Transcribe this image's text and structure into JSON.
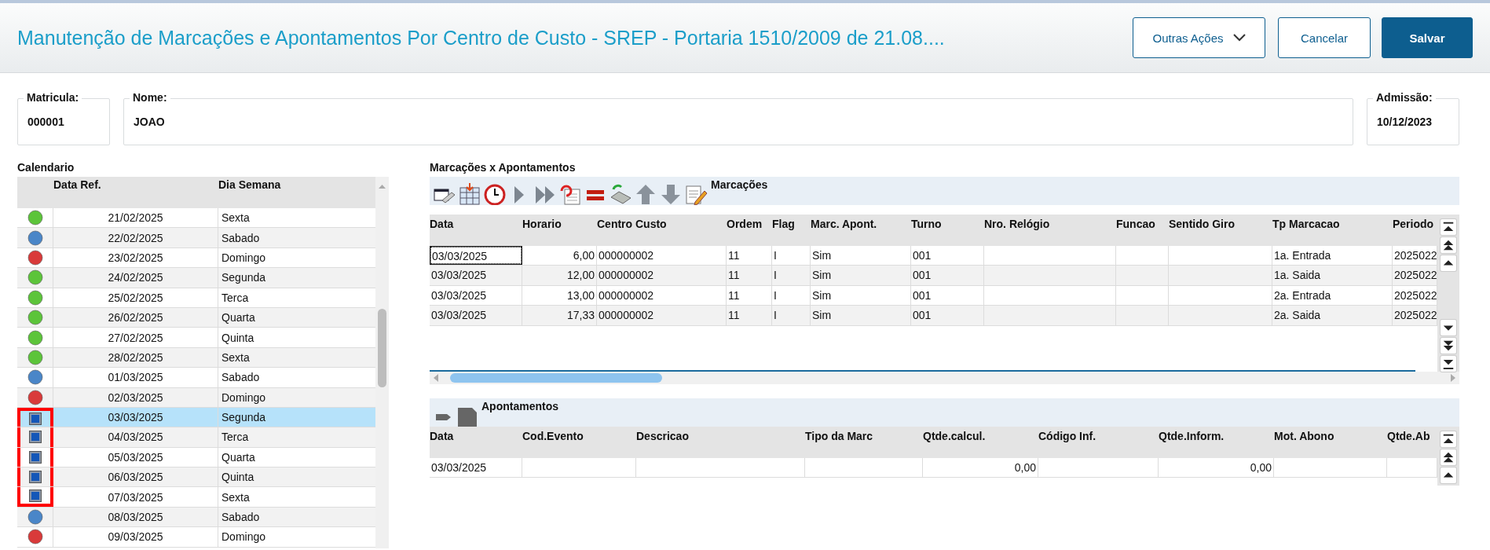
{
  "header": {
    "title": "Manutenção de Marcações e Apontamentos Por Centro de Custo - SREP - Portaria 1510/2009 de 21.08....",
    "buttons": [
      {
        "label": "Outras Ações",
        "kind": "dropdown"
      },
      {
        "label": "Cancelar",
        "kind": "secondary"
      },
      {
        "label": "Salvar",
        "kind": "primary"
      }
    ]
  },
  "fields": [
    {
      "label": "Matricula:",
      "value": "000001",
      "kind": "short"
    },
    {
      "label": "Nome:",
      "value": "JOAO",
      "kind": "wide"
    },
    {
      "label": "Admissão:",
      "value": "10/12/2023",
      "kind": "short"
    }
  ],
  "calendar": {
    "title": "Calendario",
    "columns": [
      "Data Ref.",
      "Dia Semana"
    ],
    "rows": [
      {
        "kind": "dot",
        "color": "#5cc43a",
        "date": "21/02/2025",
        "weekday": "Sexta",
        "selected": false,
        "highlighted": false
      },
      {
        "kind": "dot",
        "color": "#4a86c8",
        "date": "22/02/2025",
        "weekday": "Sabado",
        "selected": false,
        "highlighted": false
      },
      {
        "kind": "dot",
        "color": "#d93a3a",
        "date": "23/02/2025",
        "weekday": "Domingo",
        "selected": false,
        "highlighted": false
      },
      {
        "kind": "dot",
        "color": "#5cc43a",
        "date": "24/02/2025",
        "weekday": "Segunda",
        "selected": false,
        "highlighted": false
      },
      {
        "kind": "dot",
        "color": "#5cc43a",
        "date": "25/02/2025",
        "weekday": "Terca",
        "selected": false,
        "highlighted": false
      },
      {
        "kind": "dot",
        "color": "#5cc43a",
        "date": "26/02/2025",
        "weekday": "Quarta",
        "selected": false,
        "highlighted": false
      },
      {
        "kind": "dot",
        "color": "#5cc43a",
        "date": "27/02/2025",
        "weekday": "Quinta",
        "selected": false,
        "highlighted": false
      },
      {
        "kind": "dot",
        "color": "#5cc43a",
        "date": "28/02/2025",
        "weekday": "Sexta",
        "selected": false,
        "highlighted": false
      },
      {
        "kind": "dot",
        "color": "#4a86c8",
        "date": "01/03/2025",
        "weekday": "Sabado",
        "selected": false,
        "highlighted": false
      },
      {
        "kind": "dot",
        "color": "#d93a3a",
        "date": "02/03/2025",
        "weekday": "Domingo",
        "selected": false,
        "highlighted": false
      },
      {
        "kind": "square",
        "date": "03/03/2025",
        "weekday": "Segunda",
        "selected": true,
        "highlighted": true
      },
      {
        "kind": "square",
        "date": "04/03/2025",
        "weekday": "Terca",
        "selected": false,
        "highlighted": true
      },
      {
        "kind": "square",
        "date": "05/03/2025",
        "weekday": "Quarta",
        "selected": false,
        "highlighted": true
      },
      {
        "kind": "square",
        "date": "06/03/2025",
        "weekday": "Quinta",
        "selected": false,
        "highlighted": true
      },
      {
        "kind": "square",
        "date": "07/03/2025",
        "weekday": "Sexta",
        "selected": false,
        "highlighted": true
      },
      {
        "kind": "dot",
        "color": "#4a86c8",
        "date": "08/03/2025",
        "weekday": "Sabado",
        "selected": false,
        "highlighted": false
      },
      {
        "kind": "dot",
        "color": "#d93a3a",
        "date": "09/03/2025",
        "weekday": "Domingo",
        "selected": false,
        "highlighted": false
      }
    ]
  },
  "section_title": "Marcações x Apontamentos",
  "marcacoes": {
    "title": "Marcações",
    "columns": [
      "Data",
      "Horario",
      "Centro Custo",
      "Ordem",
      "Flag",
      "Marc. Apont.",
      "Turno",
      "Nro. Relógio",
      "Funcao",
      "Sentido Giro",
      "Tp Marcacao",
      "Periodo"
    ],
    "rows": [
      [
        "03/03/2025",
        "6,00",
        "000000002",
        "11",
        "I",
        "Sim",
        "001",
        "",
        "",
        "",
        "1a. Entrada",
        "2025022"
      ],
      [
        "03/03/2025",
        "12,00",
        "000000002",
        "11",
        "I",
        "Sim",
        "001",
        "",
        "",
        "",
        "1a. Saida",
        "2025022"
      ],
      [
        "03/03/2025",
        "13,00",
        "000000002",
        "11",
        "I",
        "Sim",
        "001",
        "",
        "",
        "",
        "2a. Entrada",
        "2025022"
      ],
      [
        "03/03/2025",
        "17,33",
        "000000002",
        "11",
        "I",
        "Sim",
        "001",
        "",
        "",
        "",
        "2a. Saida",
        "2025022"
      ]
    ]
  },
  "apontamentos": {
    "title": "Apontamentos",
    "columns": [
      "Data",
      "Cod.Evento",
      "Descricao",
      "Tipo da Marc",
      "Qtde.calcul.",
      "Código Inf.",
      "Qtde.Inform.",
      "Mot. Abono",
      "Qtde.Ab"
    ],
    "rows": [
      [
        "03/03/2025",
        "",
        "",
        "",
        "0,00",
        "",
        "0,00",
        "",
        ""
      ]
    ]
  }
}
